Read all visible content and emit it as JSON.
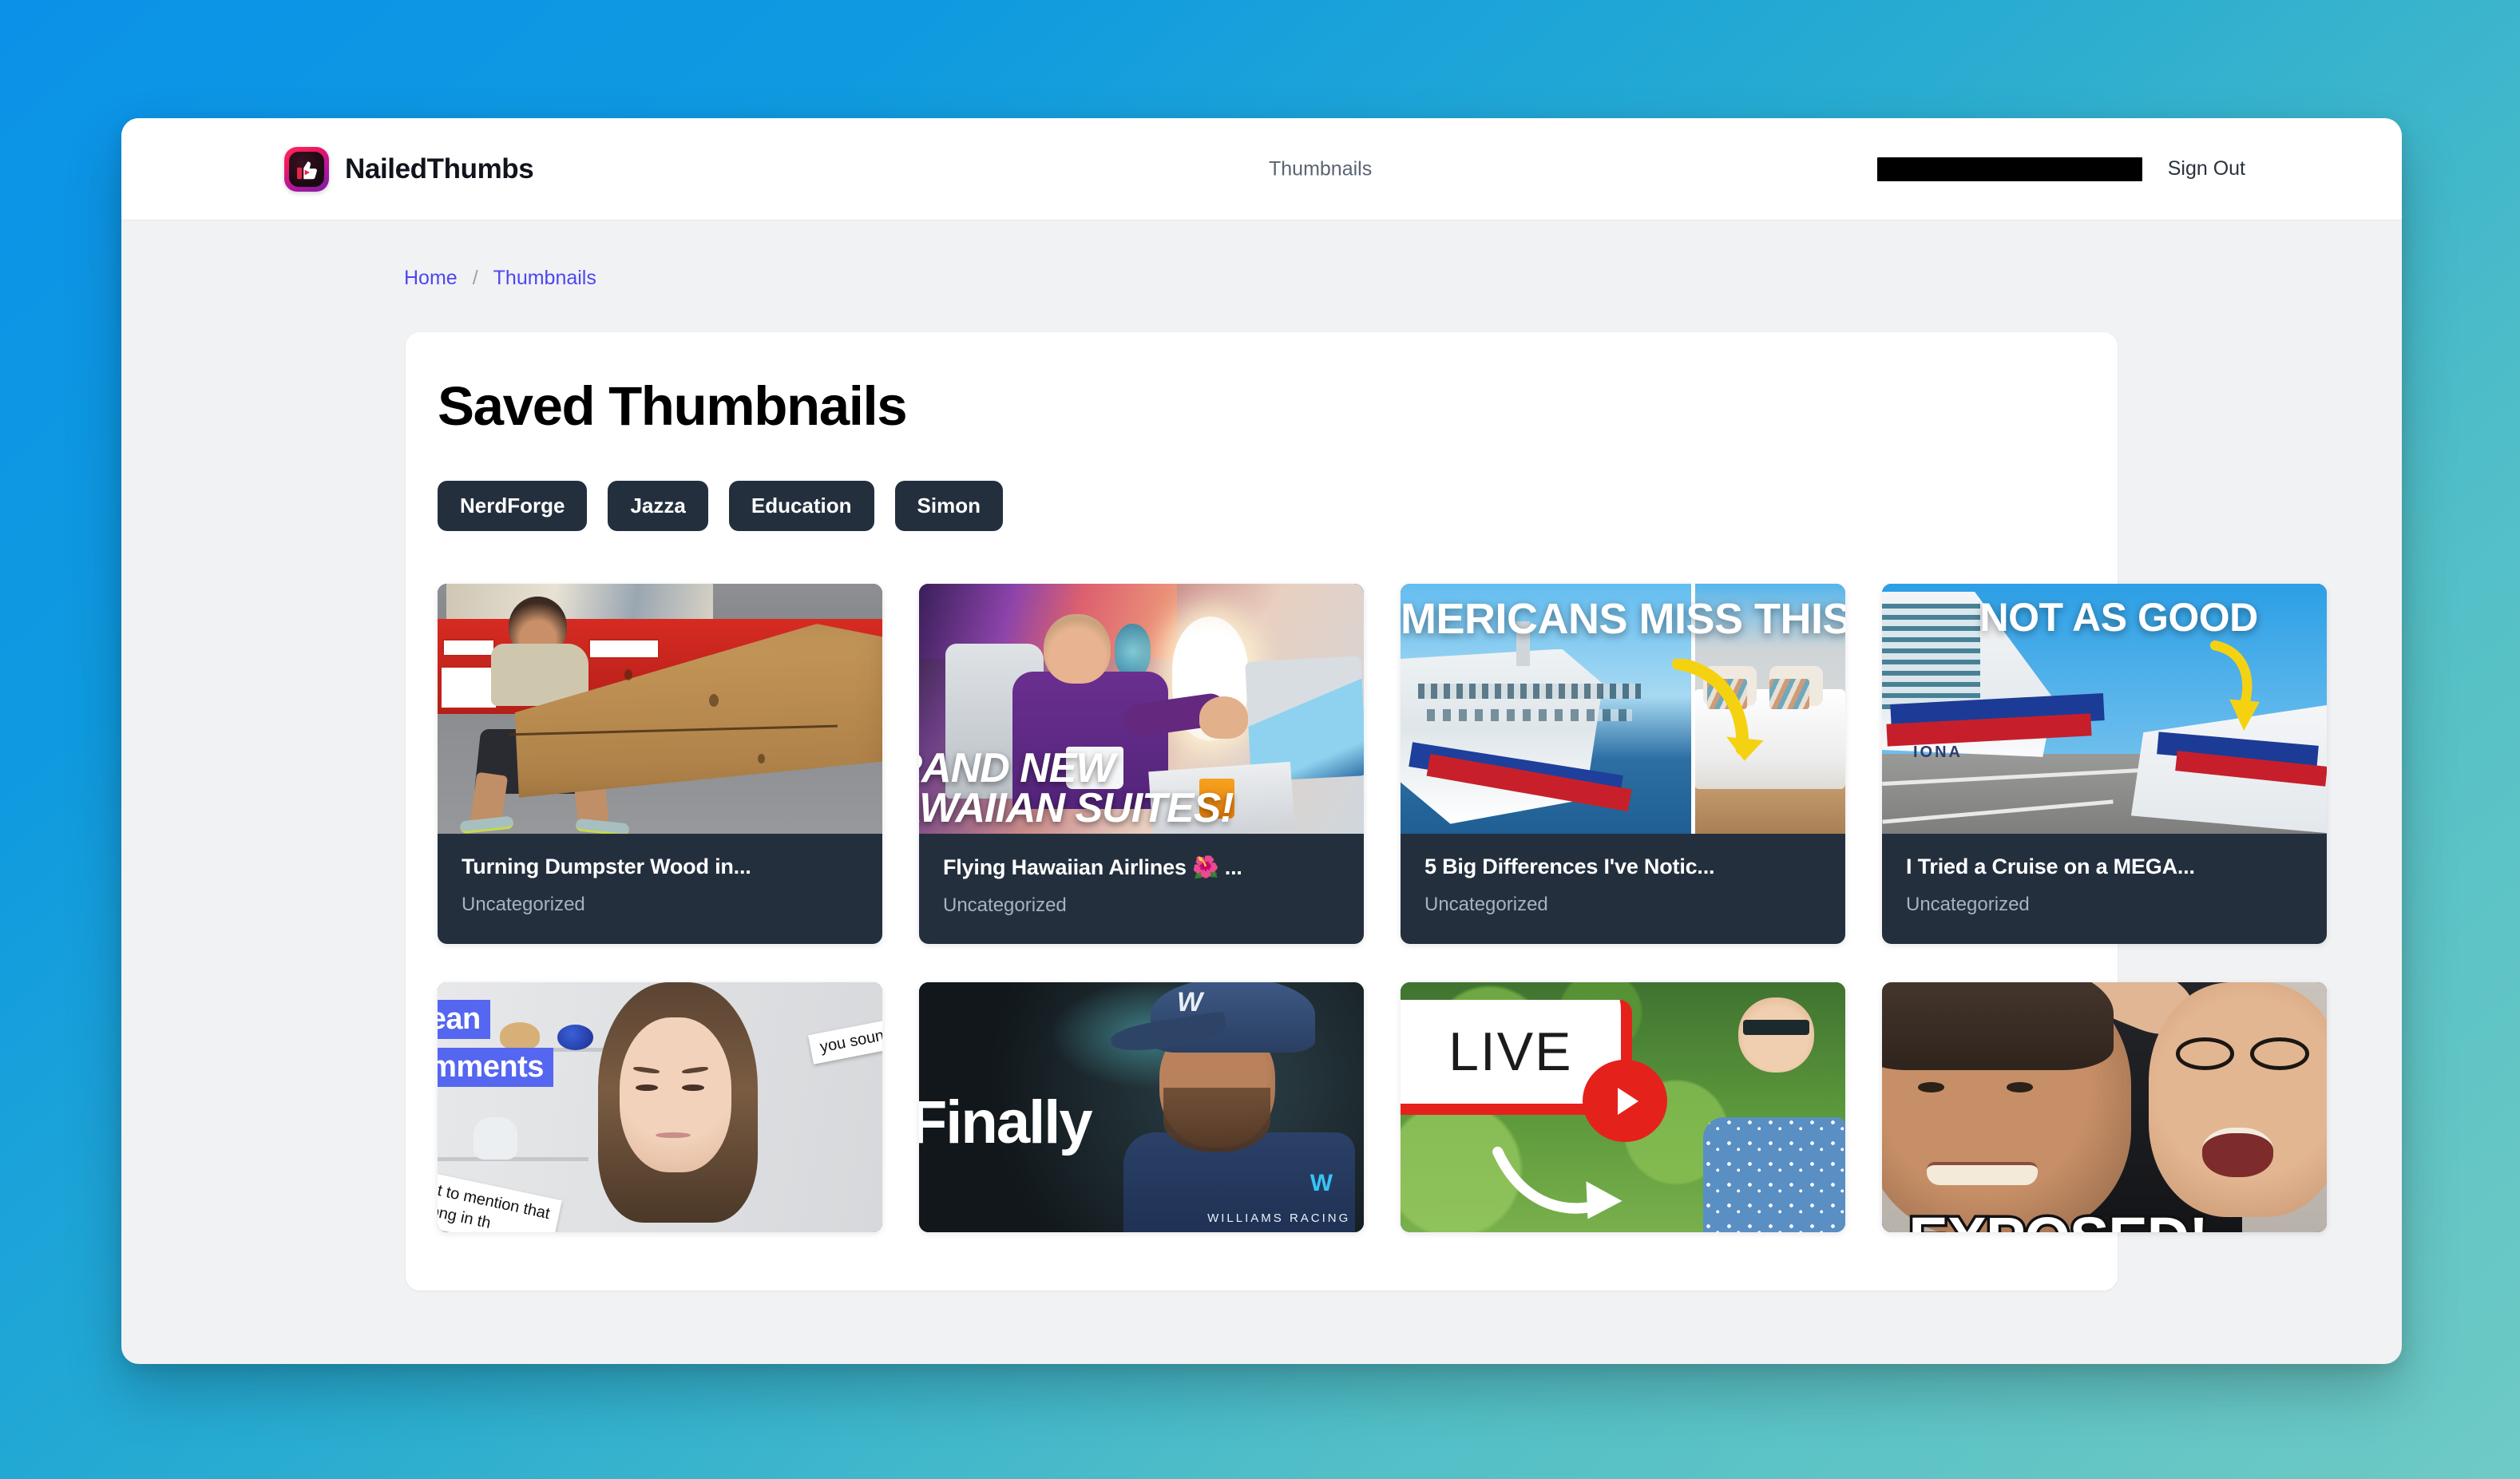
{
  "header": {
    "brand_name": "NailedThumbs",
    "logo_icon": "thumbs-up-play-logo",
    "nav_link": "Thumbnails",
    "user_redacted": "",
    "sign_out": "Sign Out"
  },
  "breadcrumb": {
    "home": "Home",
    "separator": "/",
    "current": "Thumbnails"
  },
  "main": {
    "title": "Saved Thumbnails",
    "filters": [
      "NerdForge",
      "Jazza",
      "Education",
      "Simon"
    ],
    "cards": [
      {
        "title": "Turning Dumpster Wood in...",
        "category": "Uncategorized",
        "overlay_text": ""
      },
      {
        "title": "Flying Hawaiian Airlines 🌺 ...",
        "category": "Uncategorized",
        "overlay_text": "RAND NEW\nAWAIIAN SUITES!"
      },
      {
        "title": "5 Big Differences I've Notic...",
        "category": "Uncategorized",
        "overlay_text": "MERICANS MISS THIS"
      },
      {
        "title": "I Tried a Cruise on a MEGA...",
        "category": "Uncategorized",
        "overlay_text": "NOT AS GOOD",
        "ship_name": "IONA"
      },
      {
        "title": "",
        "category": "",
        "overlay_text": "ean",
        "overlay_text2": "omments",
        "note1": "you sound like a",
        "note2": "orgot to mention that\ns wrong in th"
      },
      {
        "title": "",
        "category": "",
        "overlay_text": "Finally",
        "cap_letter": "W",
        "brand_mark": "W",
        "brand_text": "WILLIAMS RACING"
      },
      {
        "title": "",
        "category": "",
        "overlay_text": "LIVE"
      },
      {
        "title": "",
        "category": "",
        "overlay_text": "EXPOSED!"
      }
    ]
  },
  "colors": {
    "page_gradient_start": "#0b92e8",
    "page_gradient_end": "#6ecac4",
    "accent_link": "#4f46f0",
    "chip_bg": "#242f3e",
    "card_bg": "#242f3e",
    "card_subtitle": "#a9b1be"
  }
}
